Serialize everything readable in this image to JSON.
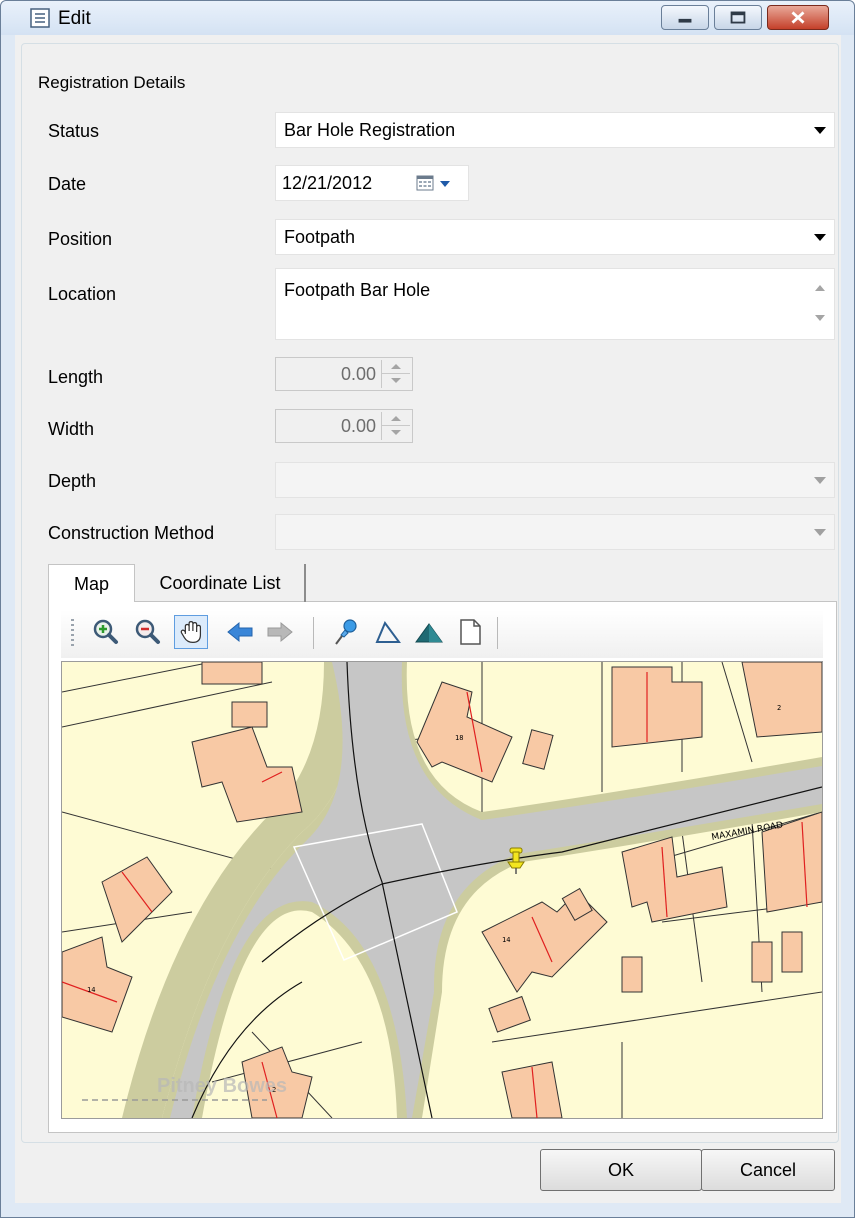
{
  "window": {
    "title": "Edit",
    "icons": {
      "title": "document-icon",
      "minimize": "minimize-icon",
      "maximize": "maximize-icon",
      "close": "close-icon"
    }
  },
  "group": {
    "label": "Registration Details"
  },
  "fields": {
    "status": {
      "label": "Status",
      "value": "Bar Hole Registration"
    },
    "date": {
      "label": "Date",
      "value": "12/21/2012"
    },
    "position": {
      "label": "Position",
      "value": "Footpath"
    },
    "location": {
      "label": "Location",
      "value": "Footpath Bar Hole"
    },
    "length": {
      "label": "Length",
      "value": "0.00"
    },
    "width": {
      "label": "Width",
      "value": "0.00"
    },
    "depth": {
      "label": "Depth",
      "value": ""
    },
    "construction_method": {
      "label": "Construction Method",
      "value": ""
    }
  },
  "tabs": [
    {
      "label": "Map",
      "active": true
    },
    {
      "label": "Coordinate List",
      "active": false
    }
  ],
  "toolbar": {
    "tools": [
      "zoom-in-icon",
      "zoom-out-icon",
      "pan-hand-icon",
      "back-arrow-icon",
      "forward-arrow-icon",
      "pushpin-icon",
      "polyline-icon",
      "polygon-icon",
      "new-page-icon"
    ]
  },
  "map": {
    "road_label": "MAXAMIN ROAD",
    "watermark": "Pitney Bowes",
    "house_numbers": [
      "18",
      "2",
      "14",
      "14",
      "2"
    ],
    "colors": {
      "land": "#fefbd4",
      "road": "#c6c6c6",
      "verge": "#cccc9f",
      "building": "#f8c9a5"
    }
  },
  "buttons": {
    "ok": "OK",
    "cancel": "Cancel"
  }
}
